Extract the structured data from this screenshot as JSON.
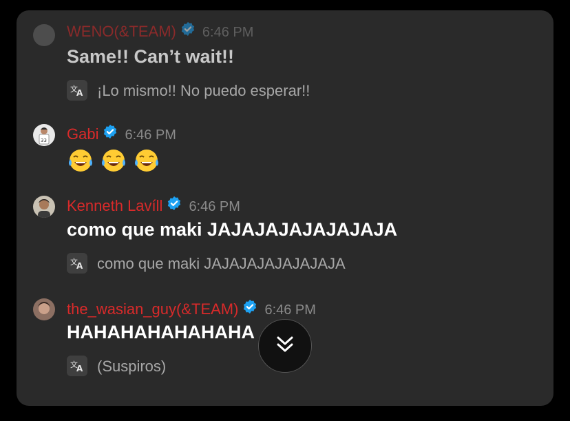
{
  "messages": [
    {
      "user": "WENO(&TEAM)",
      "time": "6:46 PM",
      "text": "Same!! Can’t wait!!",
      "translation": "¡Lo mismo!! No puedo esperar!!",
      "verified": true
    },
    {
      "user": "Gabi",
      "time": "6:46 PM",
      "text": "😂😂😂",
      "verified": true
    },
    {
      "user": "Kenneth Lavíll",
      "time": "6:46 PM",
      "text": "como que maki JAJAJAJAJAJAJAJA",
      "translation": "como que maki JAJAJAJAJAJAJAJA",
      "verified": true
    },
    {
      "user": "the_wasian_guy(&TEAM)",
      "time": "6:46 PM",
      "text": "HAHAHAHAHAHAHA",
      "translation": "(Suspiros)",
      "verified": true
    }
  ],
  "icons": {
    "verified": "verified-badge-icon",
    "translate": "translate-icon",
    "scroll": "chevrons-down-icon",
    "emoji": "face-with-tears-of-joy"
  },
  "colors": {
    "username": "#d92a2a",
    "verified": "#1da1f2",
    "panel": "#2a2a2a"
  }
}
